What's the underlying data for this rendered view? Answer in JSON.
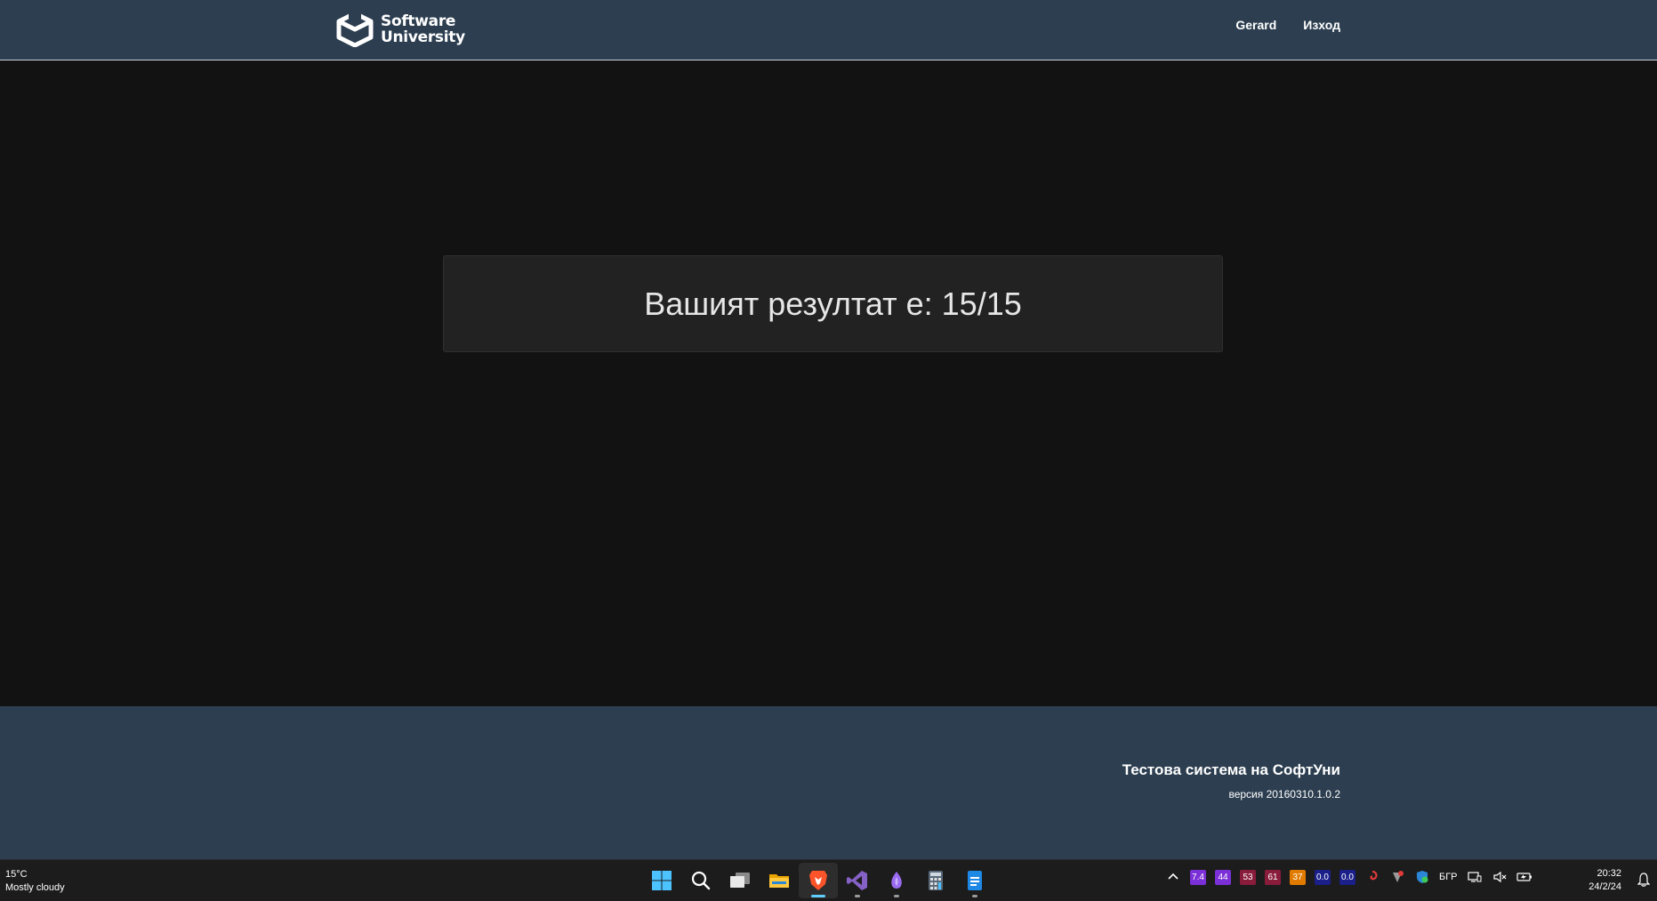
{
  "header": {
    "logo_line1": "Software",
    "logo_line2": "University",
    "user_link": "Gerard",
    "logout_link": "Изход"
  },
  "main": {
    "result_text": "Вашият резултат е: 15/15"
  },
  "footer": {
    "title": "Тестова система на СофтУни",
    "version": "версия 20160310.1.0.2"
  },
  "taskbar": {
    "weather_temp": "15°C",
    "weather_desc": "Mostly cloudy",
    "apps": [
      {
        "name": "start-icon"
      },
      {
        "name": "search-icon"
      },
      {
        "name": "task-view-icon"
      },
      {
        "name": "file-explorer-icon"
      },
      {
        "name": "brave-browser-icon"
      },
      {
        "name": "visual-studio-icon"
      },
      {
        "name": "app-icon"
      },
      {
        "name": "calculator-icon"
      },
      {
        "name": "document-icon"
      }
    ],
    "tray": {
      "badges": [
        {
          "text": "7.4",
          "color": "#7b2fd6"
        },
        {
          "text": "44",
          "color": "#7b2fd6"
        },
        {
          "text": "53",
          "color": "#8a1c3b"
        },
        {
          "text": "61",
          "color": "#8a1c3b"
        },
        {
          "text": "37",
          "color": "#e07b00"
        },
        {
          "text": "0.0",
          "color": "#1a1f8a"
        },
        {
          "text": "0.0",
          "color": "#1a1f8a"
        }
      ],
      "language": "БГР"
    },
    "time": "20:32",
    "date": "24/2/24"
  },
  "colors": {
    "header_bg": "#2c3e50",
    "page_bg": "#121212",
    "panel_bg": "#222222",
    "taskbar_bg": "#1c1c1c"
  }
}
